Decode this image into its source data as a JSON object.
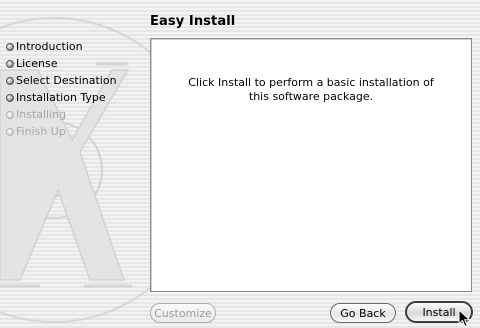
{
  "window": {
    "title": "Easy Install"
  },
  "steps": [
    {
      "label": "Introduction",
      "state": "done"
    },
    {
      "label": "License",
      "state": "done"
    },
    {
      "label": "Select Destination",
      "state": "done"
    },
    {
      "label": "Installation Type",
      "state": "current"
    },
    {
      "label": "Installing",
      "state": "pending"
    },
    {
      "label": "Finish Up",
      "state": "pending"
    }
  ],
  "panel": {
    "message": "Click Install to perform a basic installation of this software package."
  },
  "buttons": {
    "customize": "Customize",
    "go_back": "Go Back",
    "install": "Install"
  },
  "colors": {
    "pending_text": "#a8a8a8",
    "panel_bg": "#ffffff",
    "panel_border": "#8a8a8a"
  }
}
